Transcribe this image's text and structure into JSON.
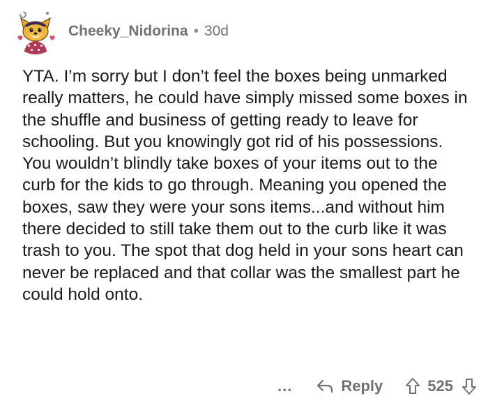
{
  "comment": {
    "username": "Cheeky_Nidorina",
    "separator": "•",
    "age": "30d",
    "avatar_icon": "user-avatar-dog-icon",
    "body": "YTA. I’m sorry but I don’t feel the boxes being unmarked really matters, he could have simply missed some boxes in the shuffle and business of getting ready to leave for schooling. But you knowingly got rid of his possessions. You wouldn’t blindly take boxes of your items out to the curb for the kids to go through. Meaning you opened the boxes, saw they were your sons items...and without him there decided to still take them out to the curb like it was trash to you. The spot that dog held in your sons heart can never be replaced and that collar was the smallest part he could hold onto."
  },
  "actions": {
    "more_label": "...",
    "reply_label": "Reply",
    "reply_icon": "reply-arrow-icon",
    "upvote_icon": "upvote-arrow-icon",
    "vote_count": "525",
    "downvote_icon": "downvote-arrow-icon"
  },
  "colors": {
    "text": "#1a1a1b",
    "meta": "#6f7275",
    "background": "#ffffff"
  }
}
